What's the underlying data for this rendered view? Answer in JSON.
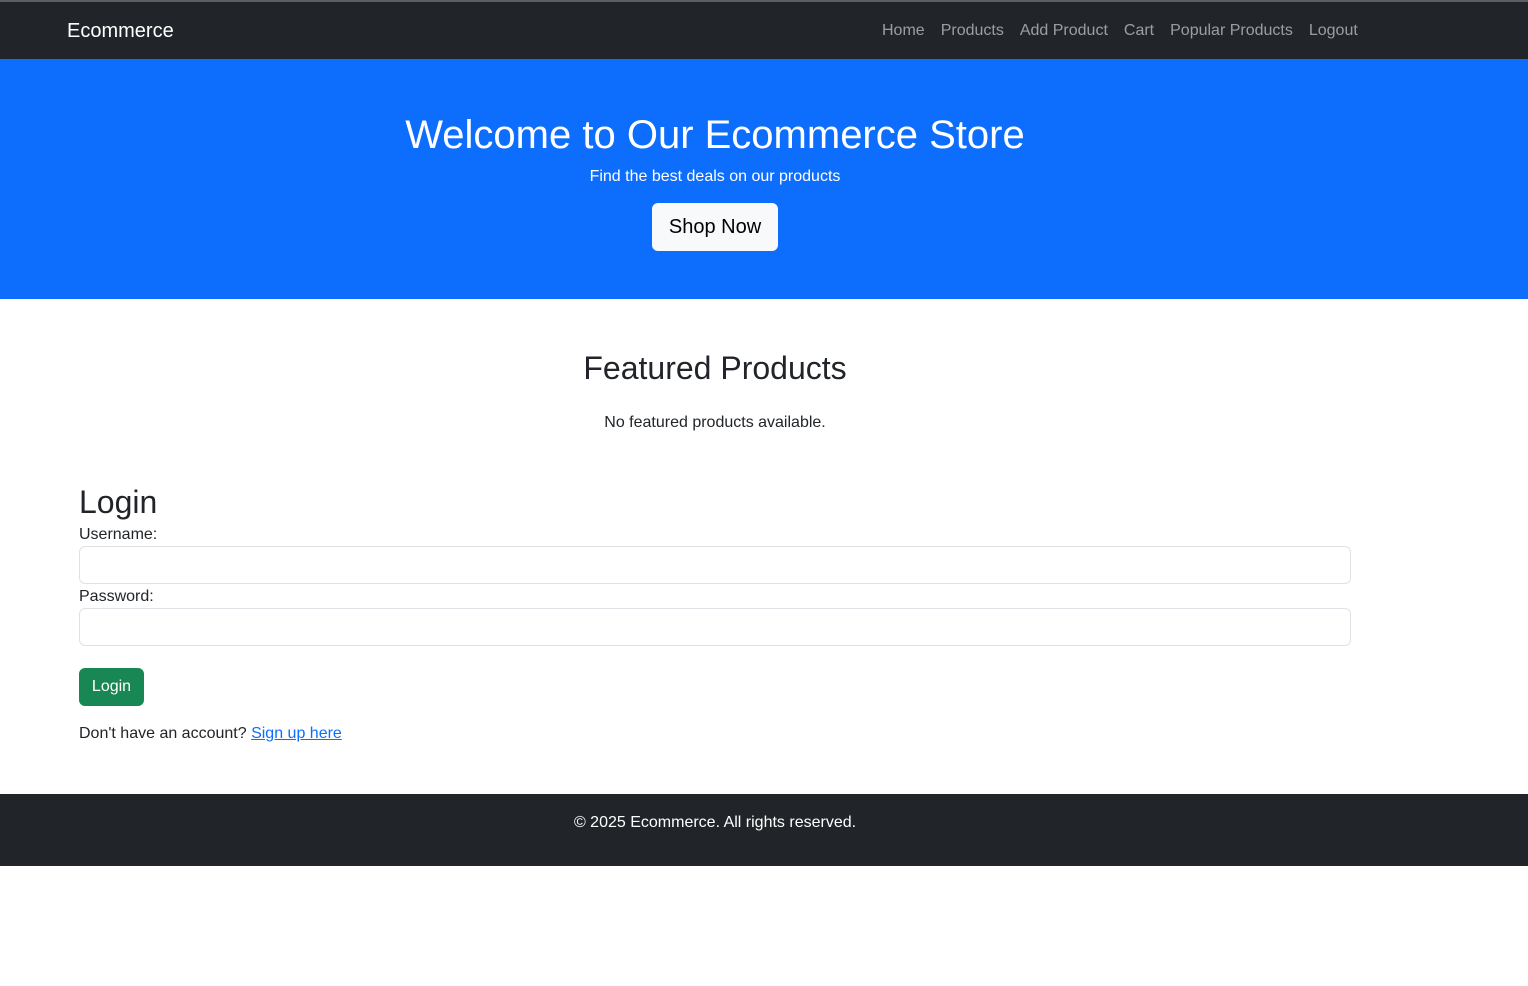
{
  "navbar": {
    "brand": "Ecommerce",
    "links": [
      "Home",
      "Products",
      "Add Product",
      "Cart",
      "Popular Products",
      "Logout"
    ]
  },
  "hero": {
    "title": "Welcome to Our Ecommerce Store",
    "subtitle": "Find the best deals on our products",
    "button_label": "Shop Now"
  },
  "featured": {
    "title": "Featured Products",
    "empty_message": "No featured products available."
  },
  "login": {
    "title": "Login",
    "username_label": "Username:",
    "username_value": "",
    "password_label": "Password:",
    "password_value": "",
    "button_label": "Login",
    "signup_prompt": "Don't have an account?",
    "signup_link": "Sign up here"
  },
  "footer": {
    "text": "© 2025 Ecommerce. All rights reserved."
  },
  "colors": {
    "navbar_bg": "#212529",
    "hero_bg": "#0d6efd",
    "login_button": "#198754",
    "link": "#0d6efd"
  }
}
